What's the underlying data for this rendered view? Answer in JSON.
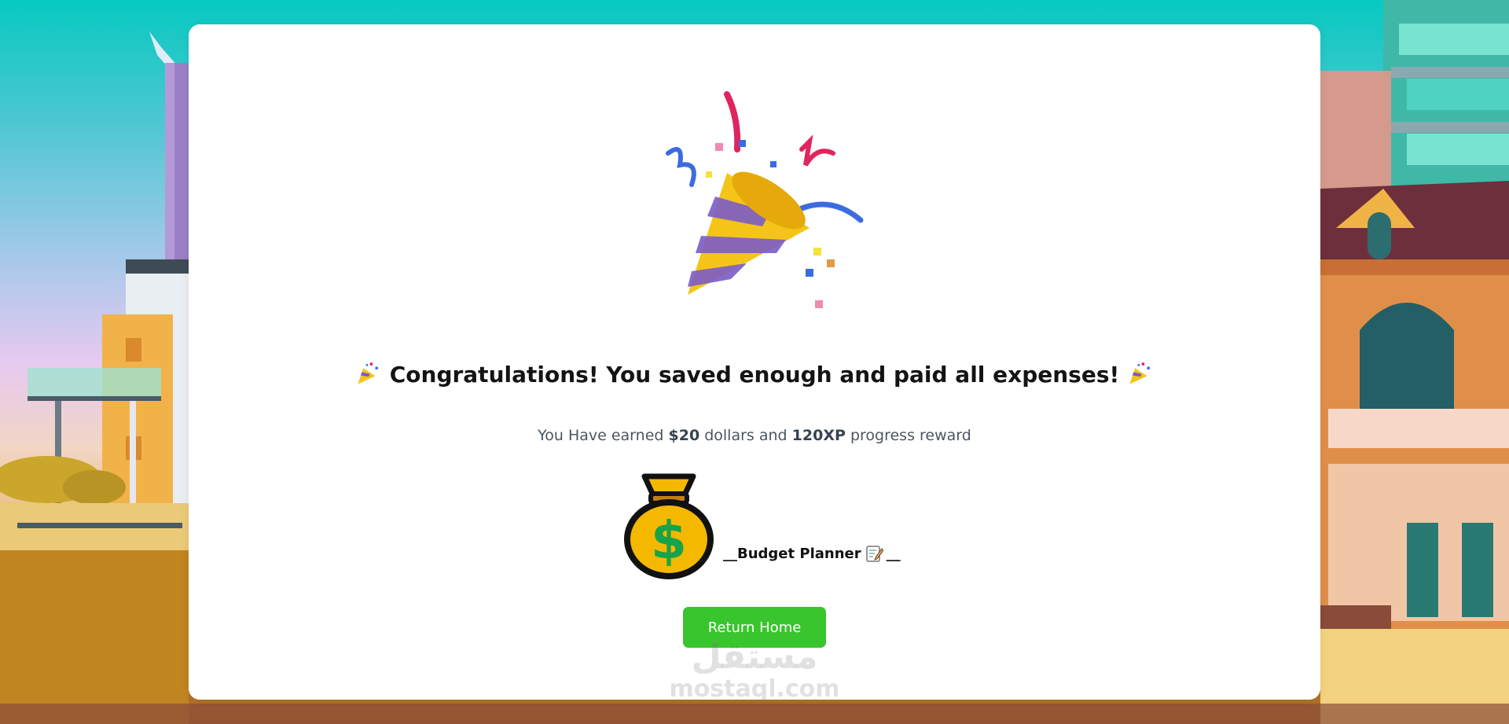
{
  "dialog": {
    "title": "Congratulations! You saved enough and paid all expenses!",
    "subtitle_prefix": "You Have earned",
    "reward_money": "$20",
    "subtitle_middle": "dollars and",
    "reward_xp": "120XP",
    "subtitle_suffix": "progress reward",
    "planner_label": "__Budget Planner",
    "planner_suffix": "__",
    "return_button": "Return Home"
  },
  "icons": {
    "hero": "party-popper-icon",
    "title_decor": "party-popper-icon",
    "money": "money-bag-icon",
    "planner": "memo-icon"
  },
  "colors": {
    "button": "#39c52d",
    "card": "#ffffff",
    "sky_top": "#06c9bf"
  },
  "watermark": {
    "arabic": "مستقل",
    "latin": "mostaql.com"
  }
}
